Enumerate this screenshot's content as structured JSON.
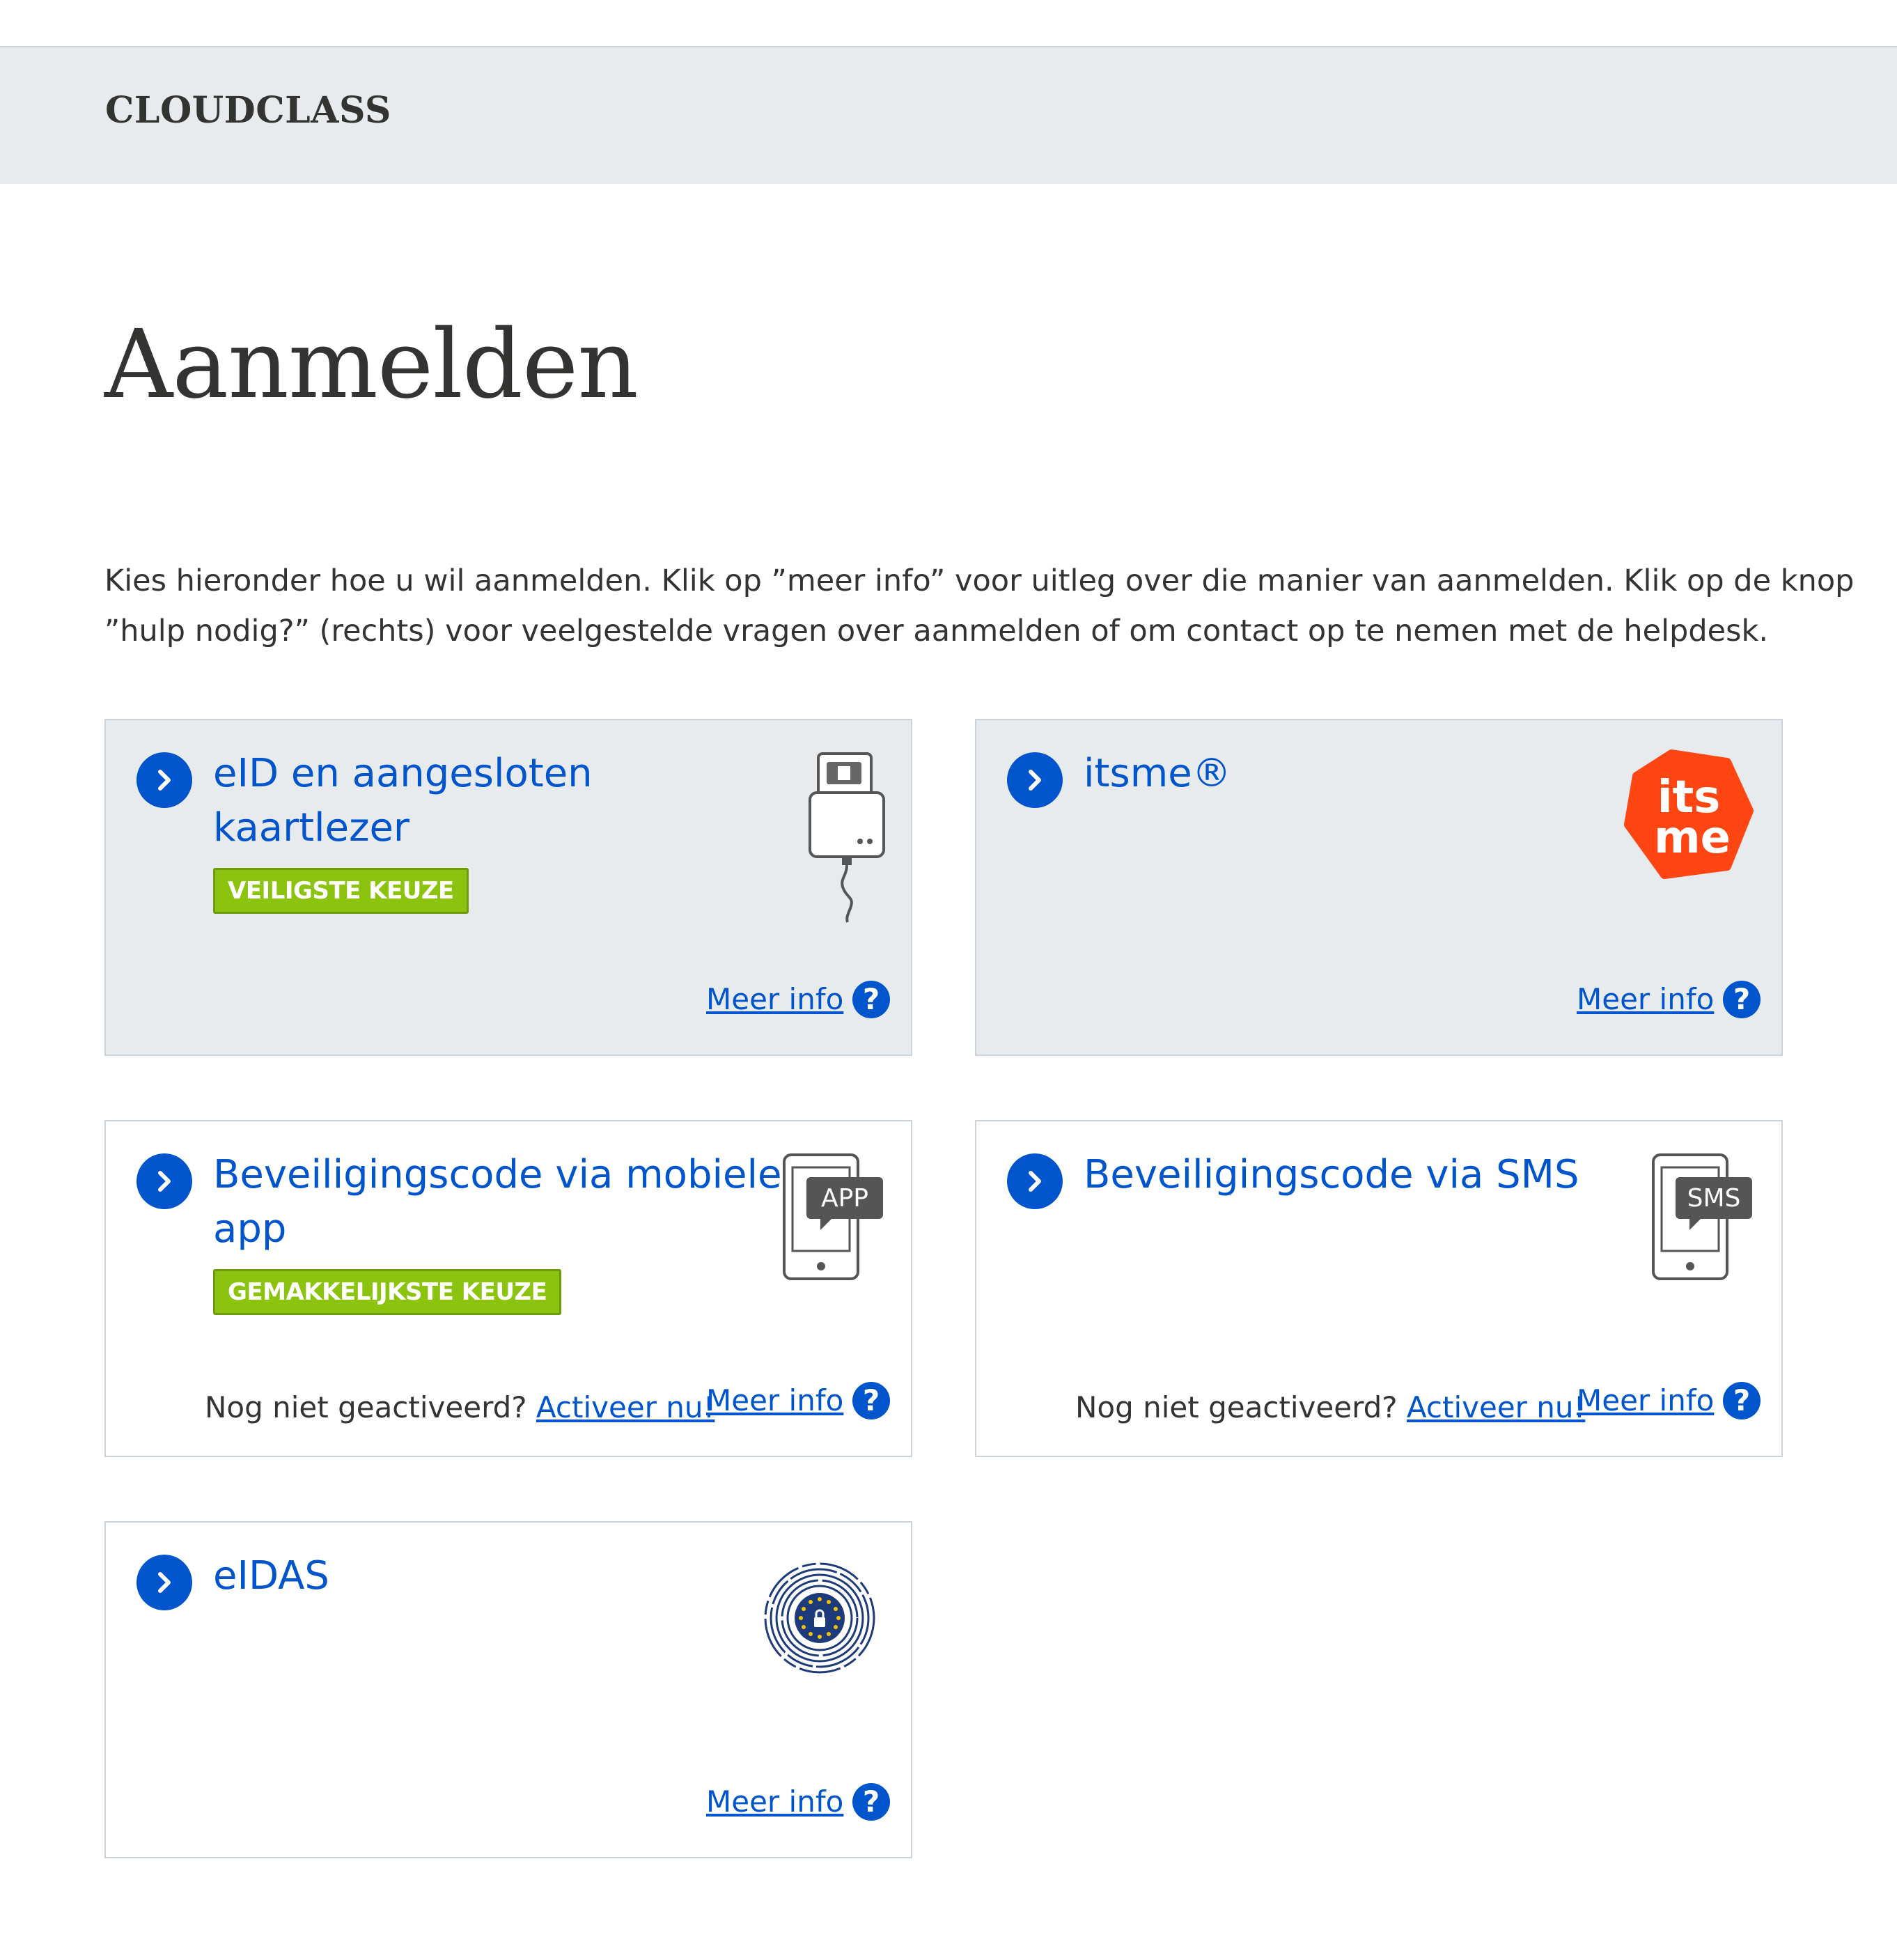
{
  "header": {
    "brand": "CLOUDCLASS"
  },
  "page": {
    "title": "Aanmelden",
    "intro_line1": "Kies hieronder hoe u wil aanmelden. Klik op ”meer info” voor uitleg over die manier van aanmelden. Klik op de knop",
    "intro_line2": "”hulp nodig?” (rechts) voor veelgestelde vragen over aanmelden of om contact op te nemen met de helpdesk."
  },
  "common": {
    "meer_info": "Meer info",
    "help_symbol": "?",
    "not_activated": "Nog niet geactiveerd?",
    "activate_now": "Activeer nu!"
  },
  "options": {
    "eid": {
      "title_line1": "eID en aangesloten",
      "title_line2": "kaartlezer",
      "badge": "VEILIGSTE KEUZE",
      "icon": "card-reader-icon"
    },
    "itsme": {
      "title": "itsme®",
      "logo_line1": "its",
      "logo_line2": "me",
      "icon": "itsme-logo"
    },
    "app": {
      "title_line1": "Beveiligingscode via mobiele",
      "title_line2": "app",
      "badge": "GEMAKKELIJKSTE KEUZE",
      "icon_label": "APP",
      "icon": "phone-app-icon"
    },
    "sms": {
      "title": "Beveiligingscode via SMS",
      "icon_label": "SMS",
      "icon": "phone-sms-icon"
    },
    "eidas": {
      "title": "eIDAS",
      "icon": "eidas-seal-icon"
    }
  },
  "colors": {
    "accent_blue": "#0055cc",
    "badge_green": "#8bc30f",
    "itsme_orange": "#ff4612",
    "card_grey": "#e8ebee",
    "border": "#cbd2da"
  }
}
